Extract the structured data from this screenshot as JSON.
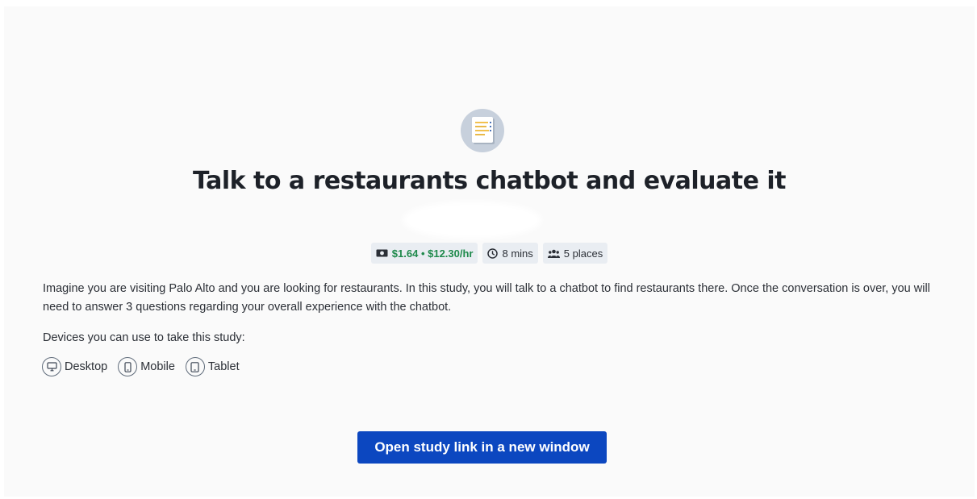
{
  "study": {
    "title": "Talk to a restaurants chatbot and evaluate it",
    "icon": "study-document-icon",
    "badges": {
      "reward": "$1.64 • $12.30/hr",
      "duration": "8 mins",
      "places": "5 places"
    },
    "description": "Imagine you are visiting Palo Alto and you are looking for restaurants. In this study, you will talk to a chatbot to find restaurants there. Once the conversation is over, you will need to answer 3 questions regarding your overall experience with the chatbot.",
    "devices_label": "Devices you can use to take this study:",
    "devices": [
      {
        "label": "Desktop",
        "icon": "desktop-icon"
      },
      {
        "label": "Mobile",
        "icon": "mobile-icon"
      },
      {
        "label": "Tablet",
        "icon": "tablet-icon"
      }
    ],
    "open_button_label": "Open study link in a new window"
  },
  "colors": {
    "accent": "#0c47c0",
    "reward_green": "#1f8a4c",
    "badge_bg": "#e9edf2"
  }
}
